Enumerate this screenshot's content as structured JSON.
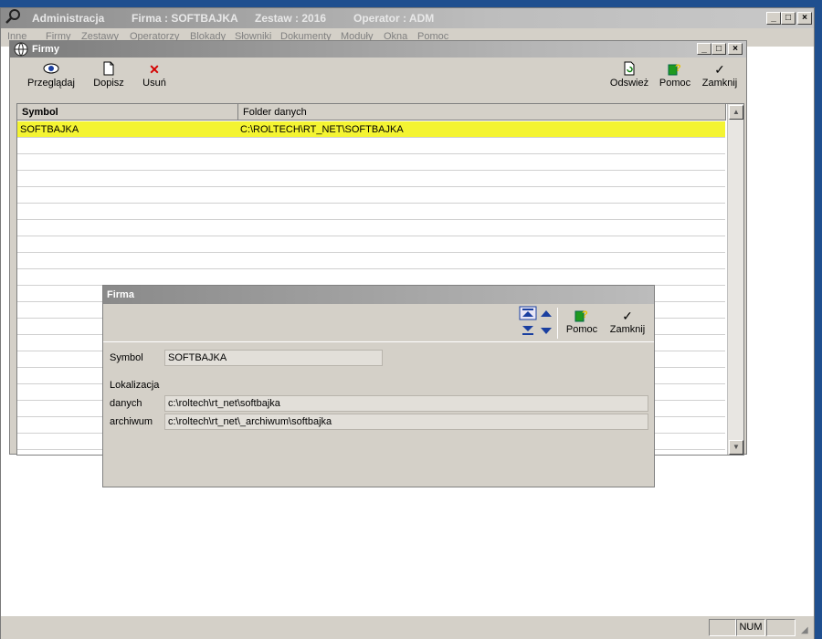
{
  "main": {
    "title_app": "Administracja",
    "title_firma": "Firma : SOFTBAJKA",
    "title_zestaw": "Zestaw : 2016",
    "title_operator": "Operator : ADM"
  },
  "menu": [
    "Inne",
    "Firmy",
    "Zestawy",
    "Operatorzy",
    "Blokady",
    "Słowniki",
    "Dokumenty",
    "Moduły",
    "Okna",
    "Pomoc"
  ],
  "firmy": {
    "title": "Firmy",
    "toolbar": {
      "browse": "Przeglądaj",
      "add": "Dopisz",
      "delete": "Usuń",
      "refresh": "Odswież",
      "help": "Pomoc",
      "close": "Zamknij"
    },
    "columns": [
      "Symbol",
      "Folder danych"
    ],
    "rows": [
      {
        "symbol": "SOFTBAJKA",
        "folder": "C:\\ROLTECH\\RT_NET\\SOFTBAJKA"
      }
    ]
  },
  "firma": {
    "title": "Firma",
    "help": "Pomoc",
    "close": "Zamknij",
    "symbol_label": "Symbol",
    "symbol_value": "SOFTBAJKA",
    "lokalizacja_label": "Lokalizacja",
    "danych_label": "danych",
    "danych_value": "c:\\roltech\\rt_net\\softbajka",
    "archiwum_label": "archiwum",
    "archiwum_value": "c:\\roltech\\rt_net\\_archiwum\\softbajka"
  },
  "status": {
    "num": "NUM"
  }
}
